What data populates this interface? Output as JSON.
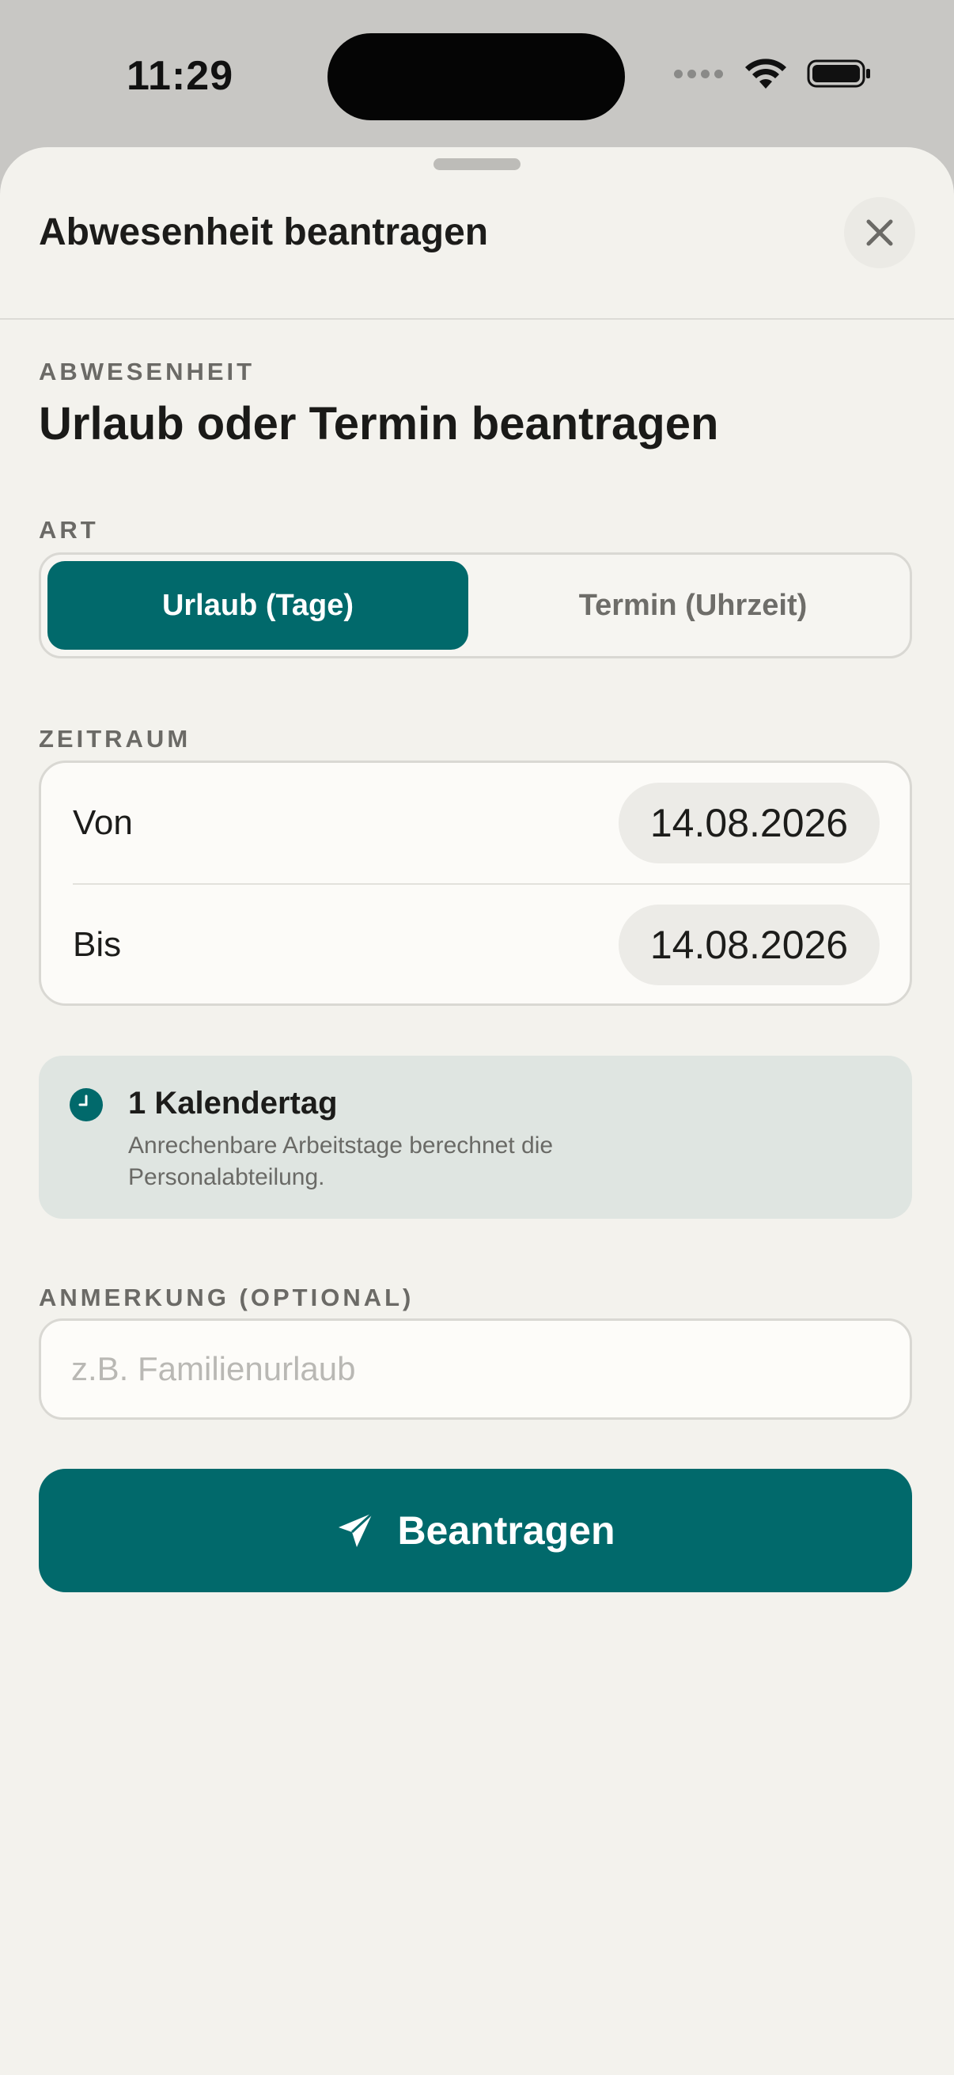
{
  "status_bar": {
    "time": "11:29"
  },
  "sheet": {
    "title": "Abwesenheit beantragen",
    "close_icon": "close-icon"
  },
  "intro": {
    "eyebrow": "ABWESENHEIT",
    "headline": "Urlaub oder Termin beantragen"
  },
  "type_section": {
    "label": "ART",
    "options": [
      {
        "label": "Urlaub (Tage)",
        "selected": true
      },
      {
        "label": "Termin (Uhrzeit)",
        "selected": false
      }
    ]
  },
  "period_section": {
    "label": "ZEITRAUM",
    "from": {
      "label": "Von",
      "value": "14.08.2026"
    },
    "to": {
      "label": "Bis",
      "value": "14.08.2026"
    }
  },
  "summary": {
    "icon": "clock-icon",
    "title": "1 Kalendertag",
    "text": "Anrechenbare Arbeitstage berechnet die Personalabteilung."
  },
  "note_section": {
    "label": "ANMERKUNG (OPTIONAL)",
    "value": "",
    "placeholder": "z.B. Familienurlaub"
  },
  "submit": {
    "label": "Beantragen",
    "icon": "send-icon"
  },
  "colors": {
    "accent": "#01696b",
    "background": "#f3f2ed",
    "info_background": "#dfe5e1"
  }
}
